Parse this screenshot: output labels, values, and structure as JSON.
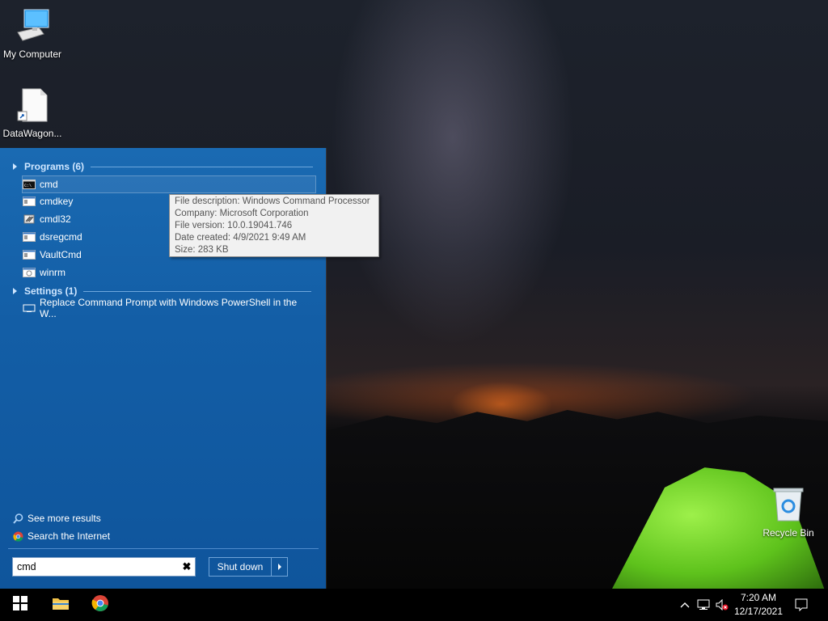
{
  "desktop": {
    "icons": [
      {
        "label": "My Computer"
      },
      {
        "label": "DataWagon..."
      },
      {
        "label": "Recycle Bin"
      }
    ]
  },
  "start_menu": {
    "groups": [
      {
        "label": "Programs (6)"
      },
      {
        "label": "Settings (1)"
      }
    ],
    "programs": [
      {
        "label": "cmd",
        "icon": "console-icon"
      },
      {
        "label": "cmdkey",
        "icon": "app-window-icon"
      },
      {
        "label": "cmdl32",
        "icon": "cmdl32-icon"
      },
      {
        "label": "dsregcmd",
        "icon": "app-window-icon"
      },
      {
        "label": "VaultCmd",
        "icon": "app-window-icon"
      },
      {
        "label": "winrm",
        "icon": "app-window-icon"
      }
    ],
    "settings": [
      {
        "label": "Replace Command Prompt with Windows PowerShell in the W...",
        "icon": "monitor-icon"
      }
    ],
    "tooltip": {
      "description": "File description: Windows Command Processor",
      "company": "Company: Microsoft Corporation",
      "version": "File version: 10.0.19041.746",
      "created": "Date created: 4/9/2021 9:49 AM",
      "size": "Size: 283 KB"
    },
    "see_more": "See more results",
    "search_internet": "Search the Internet",
    "search_value": "cmd",
    "shutdown_label": "Shut down"
  },
  "taskbar": {
    "time": "7:20 AM",
    "date": "12/17/2021"
  }
}
